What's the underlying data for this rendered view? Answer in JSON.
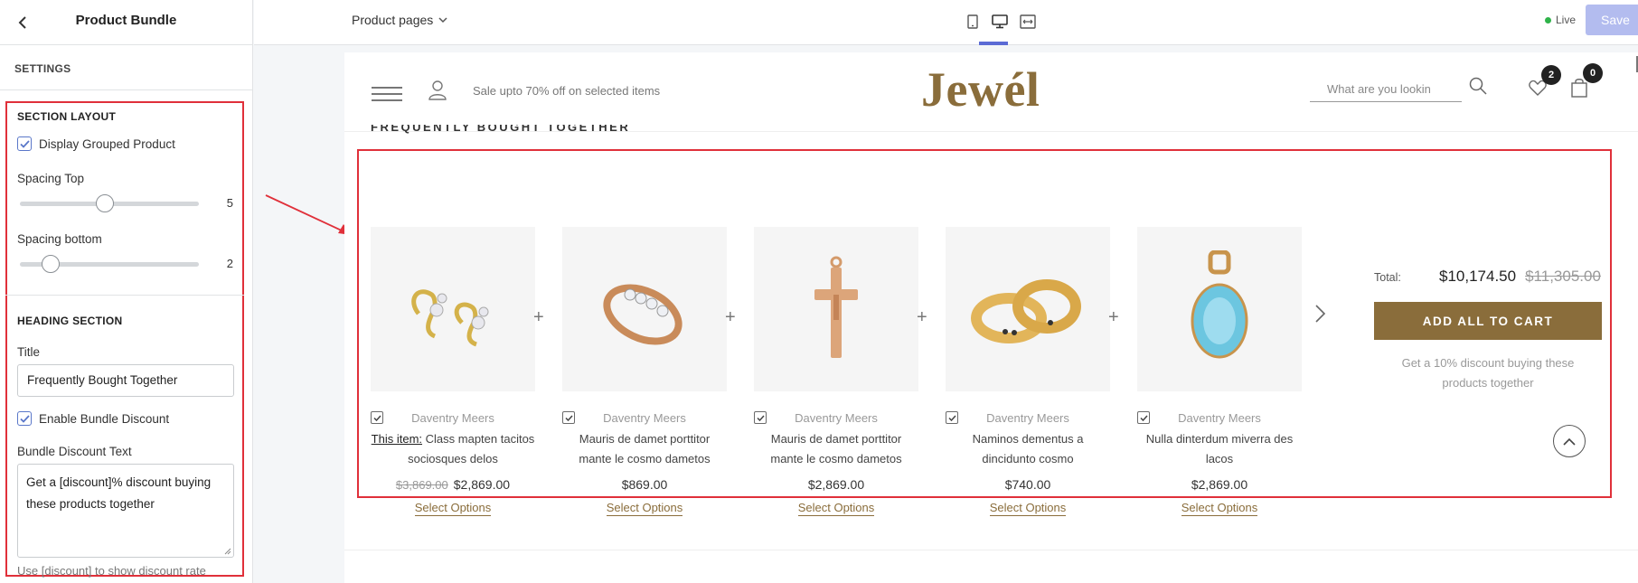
{
  "sidebar": {
    "title": "Product Bundle",
    "settings_label": "SETTINGS",
    "section_layout": {
      "heading": "SECTION LAYOUT",
      "display_grouped_label": "Display Grouped Product",
      "display_grouped_checked": true,
      "spacing_top_label": "Spacing Top",
      "spacing_top_value": "5",
      "spacing_bottom_label": "Spacing bottom",
      "spacing_bottom_value": "2"
    },
    "heading_section": {
      "heading": "HEADING SECTION",
      "title_label": "Title",
      "title_value": "Frequently Bought Together",
      "enable_discount_label": "Enable Bundle Discount",
      "enable_discount_checked": true,
      "discount_text_label": "Bundle Discount Text",
      "discount_text_value": "Get a [discount]% discount buying these products together",
      "hint": "Use [discount] to show discount rate"
    }
  },
  "topbar": {
    "page_select": "Product pages",
    "live_label": "Live",
    "save_label": "Save"
  },
  "store": {
    "promo": "Sale upto 70% off on selected items",
    "logo": "Jewél",
    "search_placeholder": "What are you lookin",
    "wishlist_count": "2",
    "cart_count": "0",
    "section_title": "FREQUENTLY BOUGHT TOGETHER",
    "products": [
      {
        "vendor": "Daventry Meers",
        "this_item": "This item:",
        "name": "Class mapten tacitos sociosques delos",
        "old_price": "$3,869.00",
        "price": "$2,869.00",
        "select": "Select Options"
      },
      {
        "vendor": "Daventry Meers",
        "this_item": "",
        "name": "Mauris de damet porttitor mante le cosmo dametos",
        "old_price": "",
        "price": "$869.00",
        "select": "Select Options"
      },
      {
        "vendor": "Daventry Meers",
        "this_item": "",
        "name": "Mauris de damet porttitor mante le cosmo dametos",
        "old_price": "",
        "price": "$2,869.00",
        "select": "Select Options"
      },
      {
        "vendor": "Daventry Meers",
        "this_item": "",
        "name": "Naminos dementus a dincidunto cosmo",
        "old_price": "",
        "price": "$740.00",
        "select": "Select Options"
      },
      {
        "vendor": "Daventry Meers",
        "this_item": "",
        "name": "Nulla dinterdum miverra des lacos",
        "old_price": "",
        "price": "$2,869.00",
        "select": "Select Options"
      }
    ],
    "total_label": "Total:",
    "total_price": "$10,174.50",
    "total_old_price": "$11,305.00",
    "add_all_label": "ADD ALL TO CART",
    "discount_note": "Get a 10% discount buying these products together"
  },
  "colors": {
    "accent_gold": "#8a6d3b",
    "highlight_red": "#e0303a",
    "save_disabled": "#b3bcef",
    "live_green": "#2fb34a"
  }
}
